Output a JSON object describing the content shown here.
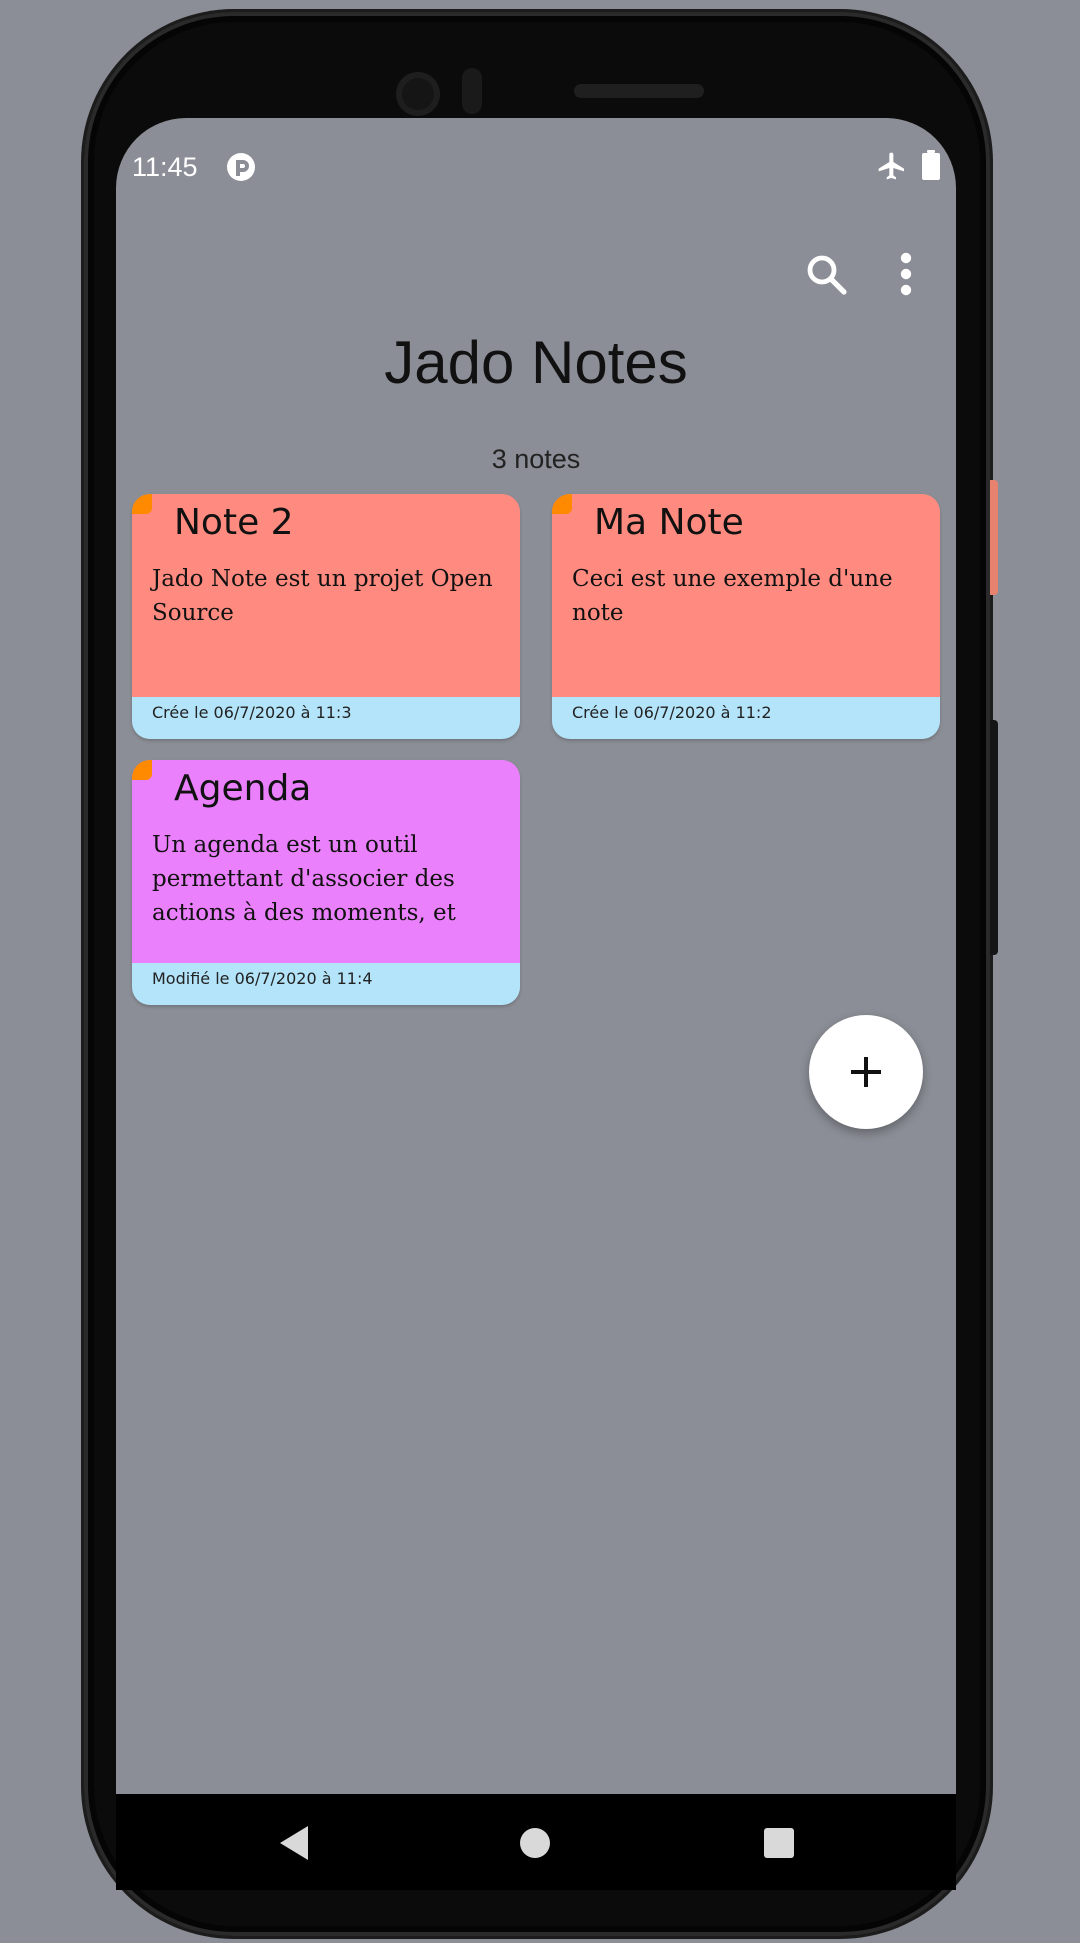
{
  "status_bar": {
    "time": "11:45",
    "icons": [
      "app-notification-icon",
      "airplane-mode-icon",
      "battery-icon"
    ]
  },
  "toolbar": {
    "actions": [
      "search-icon",
      "more-vert-icon"
    ]
  },
  "header": {
    "title": "Jado Notes",
    "count_label": "3 notes"
  },
  "notes": [
    {
      "title": "Note 2",
      "content": "Jado Note est un projet Open Source",
      "footer": "Crée le 06/7/2020 à 11:3",
      "color": "#ff8b80"
    },
    {
      "title": "Ma Note",
      "content": "Ceci est une exemple d'une note",
      "footer": "Crée le 06/7/2020 à 11:2",
      "color": "#ff8b80"
    },
    {
      "title": "Agenda",
      "content": "Un agenda est un outil permettant d'associer des actions à des moments, et",
      "footer": "Modifié le 06/7/2020 à 11:4",
      "color": "#ea80fc"
    }
  ],
  "fab": {
    "icon": "plus-icon"
  },
  "colors": {
    "background": "#8b8e96",
    "footer": "#b3e4fa",
    "corner_accent": "#ff8a00"
  },
  "nav_bar": {
    "buttons": [
      "back-icon",
      "home-icon",
      "recents-icon"
    ]
  }
}
